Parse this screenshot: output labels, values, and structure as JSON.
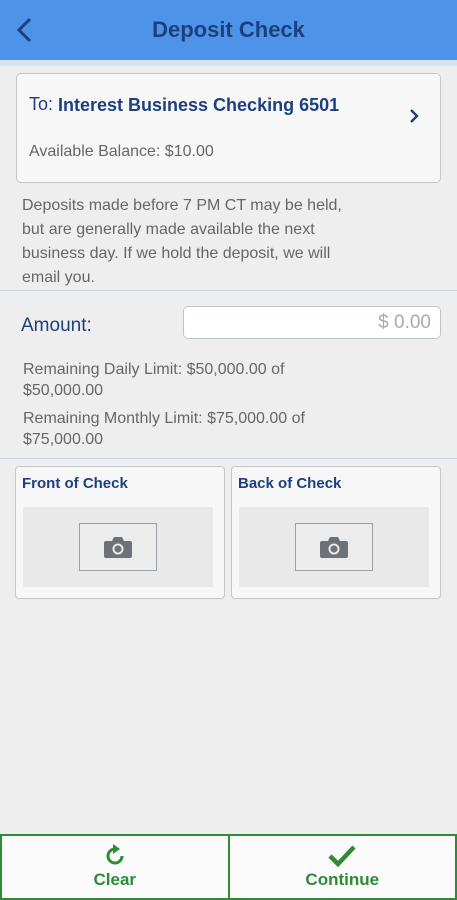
{
  "header": {
    "title": "Deposit Check"
  },
  "account": {
    "to_label": "To:",
    "name": "Interest Business Checking 6501",
    "balance": "Available Balance: $10.00"
  },
  "notice": "Deposits made before 7 PM CT may be held, but are generally made available the next business day. If we hold the deposit, we will email you.",
  "amount": {
    "label": "Amount:",
    "placeholder": "$ 0.00"
  },
  "limits": {
    "daily": "Remaining Daily Limit: $50,000.00 of $50,000.00",
    "monthly": "Remaining Monthly Limit: $75,000.00 of $75,000.00"
  },
  "checks": {
    "front_label": "Front of Check",
    "back_label": "Back of Check"
  },
  "actions": {
    "clear_label": "Clear",
    "continue_label": "Continue"
  },
  "colors": {
    "header_bg": "#4d94e8",
    "title_text": "#1d3f80",
    "action_green": "#2e8b34"
  }
}
